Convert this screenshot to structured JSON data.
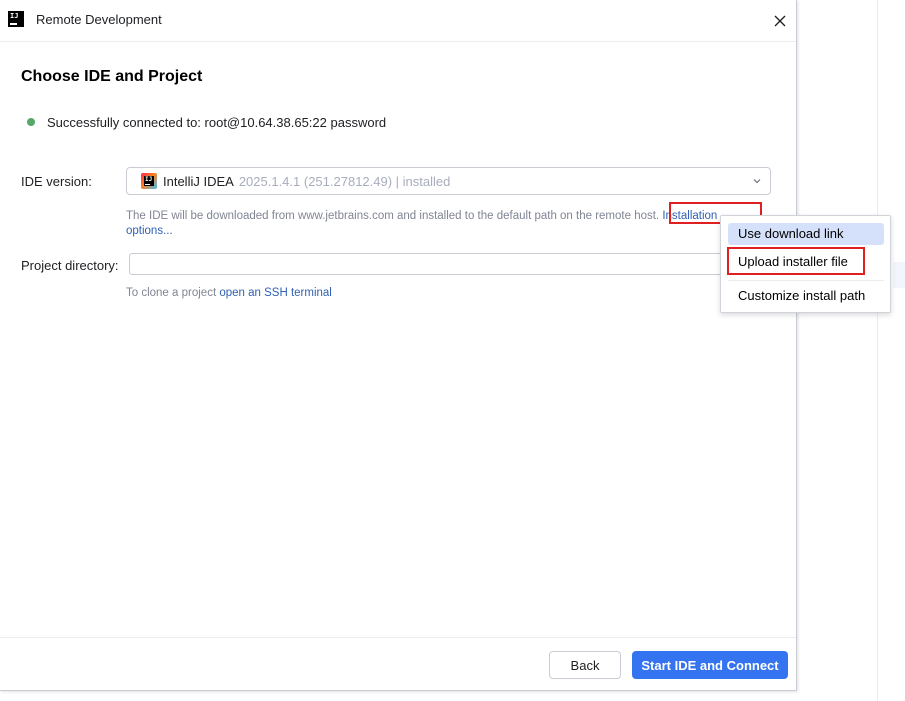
{
  "window": {
    "title": "Remote Development",
    "app_icon": "intellij-dialog-icon",
    "close_icon": "close-icon"
  },
  "page": {
    "heading": "Choose IDE and Project"
  },
  "status": {
    "text": "Successfully connected to: root@10.64.38.65:22 password",
    "color": "#55a76a"
  },
  "ide": {
    "label": "IDE version:",
    "name": "IntelliJ IDEA",
    "version": "2025.1.4.1 (251.27812.49) | installed",
    "hint_prefix": "The IDE will be downloaded from www.jetbrains.com and installed to the default path on the remote host.",
    "hint_link_a": "Installation",
    "hint_link_b": "options..."
  },
  "project": {
    "label": "Project directory:",
    "value": "",
    "clone_prefix": "To clone a project",
    "clone_link": "open an SSH terminal"
  },
  "popup": {
    "items": [
      {
        "label": "Use download link",
        "selected": true
      },
      {
        "label": "Upload installer file"
      },
      {
        "label": "Customize install path"
      }
    ]
  },
  "footer": {
    "back_label": "Back",
    "primary_label": "Start IDE and Connect",
    "accent": "#3574f0"
  },
  "annotations": {
    "color": "#e02020"
  }
}
